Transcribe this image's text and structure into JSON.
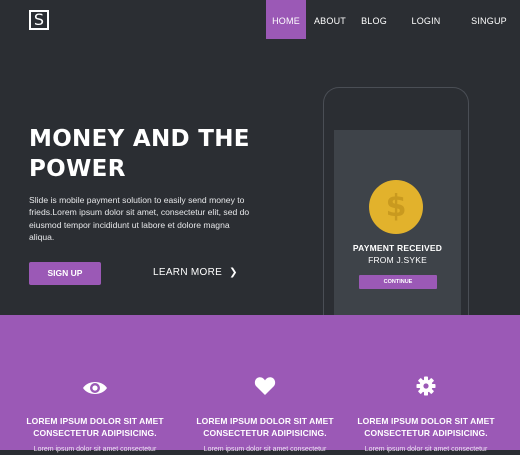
{
  "brand": {
    "logo_text": "S"
  },
  "nav": {
    "items": [
      {
        "label": "HOME",
        "active": true
      },
      {
        "label": "ABOUT",
        "active": false
      },
      {
        "label": "BLOG",
        "active": false
      },
      {
        "label": "LOGIN",
        "active": false
      },
      {
        "label": "SINGUP",
        "active": false
      }
    ]
  },
  "hero": {
    "title": "MONEY AND THE POWER",
    "description": "Slide is mobile payment solution to easily send money to frieds.Lorem ipsum dolor sit amet, consectetur elit, sed do eiusmod tempor incididunt ut labore et dolore magna aliqua.",
    "signup_label": "SIGN UP",
    "learn_more_label": "LEARN MORE",
    "learn_more_icon": "chevron-right-icon"
  },
  "phone": {
    "coin_icon": "dollar-coin-icon",
    "coin_glyph": "$",
    "title": "PAYMENT RECEIVED",
    "from": "FROM J.SYKE",
    "button": "CONTINUE"
  },
  "features": [
    {
      "icon": "eye-icon",
      "title": "LOREM IPSUM DOLOR SIT AMET CONSECTETUR ADIPISICING.",
      "body": "Lorem ipsum dolor sit amet consectetur"
    },
    {
      "icon": "heart-icon",
      "title": "LOREM IPSUM DOLOR SIT AMET CONSECTETUR ADIPISICING.",
      "body": "Lorem ipsum dolor sit amet consectetur"
    },
    {
      "icon": "gear-icon",
      "title": "LOREM IPSUM DOLOR SIT AMET CONSECTETUR ADIPISICING.",
      "body": "Lorem ipsum dolor sit amet consectetur"
    }
  ],
  "colors": {
    "background": "#2b2e33",
    "accent": "#9b59b6",
    "phone_screen": "#3e4349",
    "coin": "#e2b22c"
  }
}
